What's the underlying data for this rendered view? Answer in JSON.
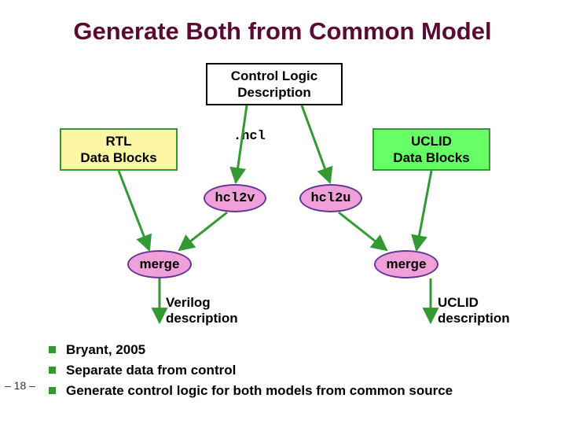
{
  "title": "Generate Both from Common Model",
  "boxes": {
    "control": {
      "line1": "Control Logic",
      "line2": "Description"
    },
    "rtl": {
      "line1": "RTL",
      "line2": "Data Blocks"
    },
    "uclid": {
      "line1": "UCLID",
      "line2": "Data Blocks"
    },
    "mergeL": "merge",
    "mergeR": "merge"
  },
  "tools": {
    "hcl2v": "hcl2v",
    "hcl2u": "hcl2u"
  },
  "hcl_ext": ".hcl",
  "outputs": {
    "verilog": {
      "line1": "Verilog",
      "line2": "description"
    },
    "uclid": {
      "line1": "UCLID",
      "line2": "description"
    }
  },
  "bullets": [
    "Bryant, 2005",
    "Separate data from control",
    "Generate control logic for both models from common source"
  ],
  "slide_num": "– 18 –"
}
